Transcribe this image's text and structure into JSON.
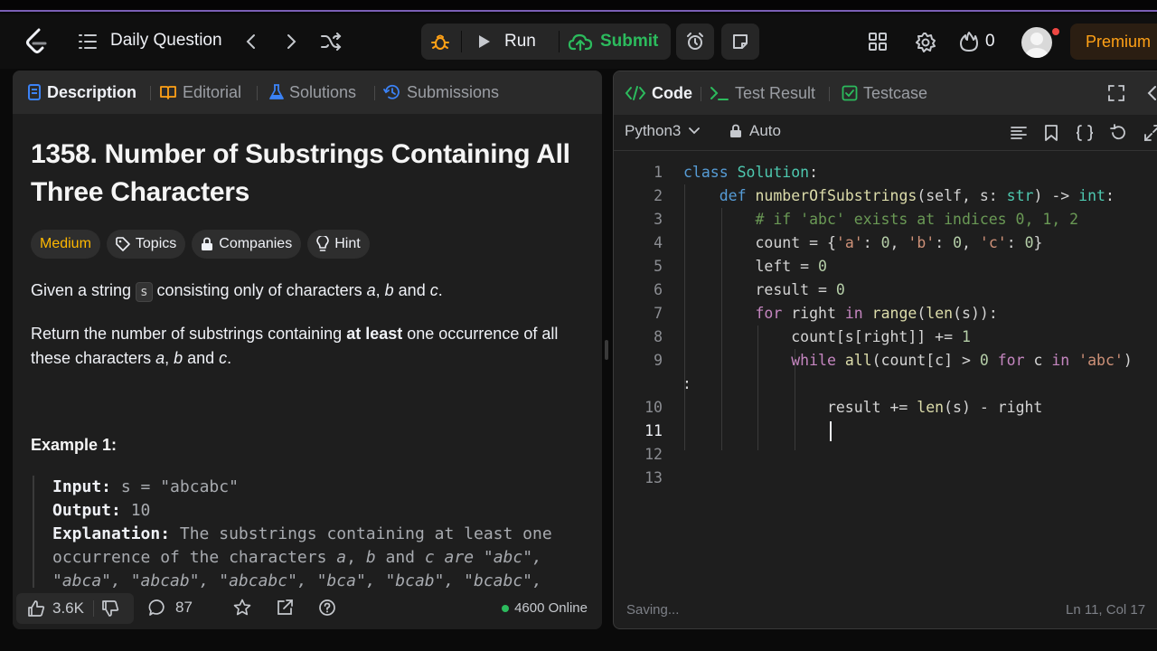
{
  "nav": {
    "daily_label": "Daily Question",
    "run_label": "Run",
    "submit_label": "Submit",
    "streak_count": "0",
    "premium_label": "Premium"
  },
  "left_tabs": [
    "Description",
    "Editorial",
    "Solutions",
    "Submissions"
  ],
  "problem": {
    "title": "1358. Number of Substrings Containing All Three Characters",
    "difficulty": "Medium",
    "chips": [
      "Topics",
      "Companies",
      "Hint"
    ],
    "p1_before": "Given a string ",
    "p1_code": "s",
    "p1_after": " consisting only of characters ",
    "p1_a": "a",
    "p1_comma": ", ",
    "p1_b": "b",
    "p1_and": " and ",
    "p1_c": "c",
    "p1_end": ".",
    "p2_before": "Return the number of substrings containing ",
    "p2_bold": "at least",
    "p2_mid": " one occurrence of all these characters ",
    "p2_a": "a",
    "p2_comma": ", ",
    "p2_b": "b",
    "p2_and": " and ",
    "p2_c": "c",
    "p2_end": ".",
    "example_title": "Example 1:",
    "input_label": "Input:",
    "input_value": " s = \"abcabc\"",
    "output_label": "Output:",
    "output_value": " 10",
    "explanation_label": "Explanation:",
    "explanation_1": " The substrings containing at least one",
    "explanation_2a": "occurrence of the characters ",
    "explanation_2b": "a",
    "explanation_2c": ", ",
    "explanation_2d": "b",
    "explanation_2e": " and ",
    "explanation_2f": "c are \"abc\",",
    "explanation_3": "\"abca\", \"abcab\", \"abcabc\", \"bca\", \"bcab\", \"bcabc\","
  },
  "footer": {
    "likes": "3.6K",
    "comments": "87",
    "online": "4600 Online"
  },
  "right_tabs": [
    "Code",
    "Test Result",
    "Testcase"
  ],
  "editor": {
    "language": "Python3",
    "mode": "Auto",
    "status": "Saving...",
    "position": "Ln 11, Col 17",
    "line_numbers": [
      "1",
      "2",
      "3",
      "4",
      "5",
      "6",
      "7",
      "8",
      "9",
      "10",
      "11",
      "12",
      "13"
    ],
    "wrap_colon": ":"
  },
  "colors": {
    "accent_green": "#2cbb5d",
    "premium": "#ffa116",
    "medium": "#ffb800"
  }
}
